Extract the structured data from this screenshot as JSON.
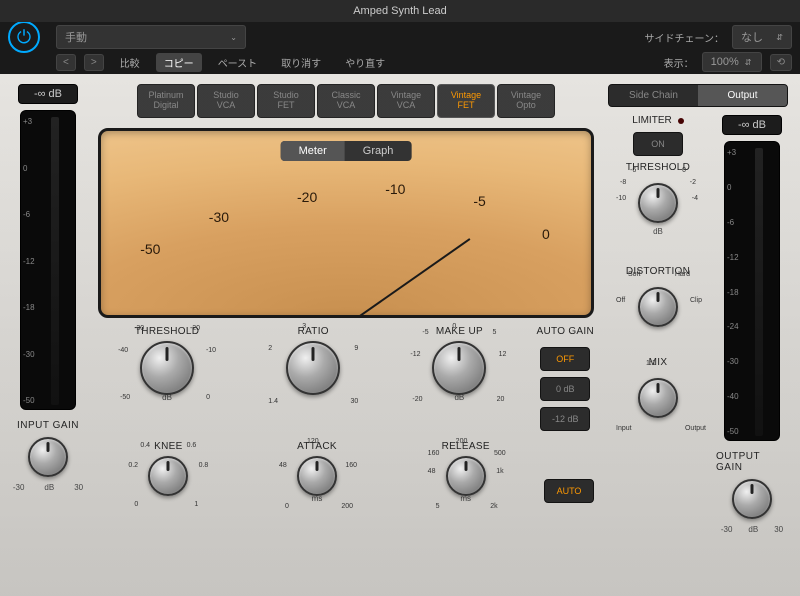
{
  "title": "Amped Synth Lead",
  "toolbar": {
    "preset": "手動",
    "compare": "比較",
    "copy": "コピー",
    "paste": "ペースト",
    "undo": "取り消す",
    "redo": "やり直す",
    "sidechain_label": "サイドチェーン：",
    "sidechain_value": "なし",
    "view_label": "表示：",
    "view_value": "100%"
  },
  "types": [
    {
      "l1": "Platinum",
      "l2": "Digital"
    },
    {
      "l1": "Studio",
      "l2": "VCA"
    },
    {
      "l1": "Studio",
      "l2": "FET"
    },
    {
      "l1": "Classic",
      "l2": "VCA"
    },
    {
      "l1": "Vintage",
      "l2": "VCA"
    },
    {
      "l1": "Vintage",
      "l2": "FET"
    },
    {
      "l1": "Vintage",
      "l2": "Opto"
    }
  ],
  "active_type": 5,
  "sc_tabs": {
    "side_chain": "Side Chain",
    "output": "Output"
  },
  "input": {
    "db": "-∞ dB",
    "label": "INPUT GAIN",
    "scale": [
      "+3",
      "0",
      "-6",
      "-12",
      "-18",
      "-30",
      "-50"
    ],
    "unit": "dB",
    "range": [
      "-30",
      "30"
    ]
  },
  "output": {
    "db": "-∞ dB",
    "label": "OUTPUT GAIN",
    "scale": [
      "+3",
      "0",
      "-6",
      "-12",
      "-18",
      "-24",
      "-30",
      "-40",
      "-50"
    ],
    "unit": "dB",
    "range": [
      "-30",
      "30"
    ]
  },
  "vu": {
    "meter": "Meter",
    "graph": "Graph",
    "marks": [
      "-50",
      "-30",
      "-20",
      "-10",
      "-5",
      "0"
    ]
  },
  "main_knobs": {
    "threshold": {
      "title": "THRESHOLD",
      "ticks": [
        "-50",
        "-40",
        "-30",
        "-20",
        "-10",
        "0"
      ],
      "unit": "dB"
    },
    "ratio": {
      "title": "RATIO",
      "ticks": [
        "1.4",
        "2",
        "3",
        "9",
        "30"
      ]
    },
    "makeup": {
      "title": "MAKE UP",
      "ticks": [
        "-20",
        "-12",
        "-5",
        "0",
        "5",
        "12",
        "20"
      ],
      "unit": "dB"
    },
    "autogain": {
      "title": "AUTO GAIN",
      "off": "OFF",
      "zero": "0 dB",
      "minus12": "-12 dB"
    }
  },
  "sub_knobs": {
    "knee": {
      "title": "KNEE",
      "ticks": [
        "0",
        "0.2",
        "0.4",
        "0.6",
        "0.8",
        "1"
      ]
    },
    "attack": {
      "title": "ATTACK",
      "ticks": [
        "0",
        "48",
        "120",
        "160",
        "200"
      ],
      "unit": "ms"
    },
    "release": {
      "title": "RELEASE",
      "ticks": [
        "5",
        "48",
        "160",
        "200",
        "500",
        "1k",
        "2k"
      ],
      "unit": "ms"
    },
    "auto": "AUTO"
  },
  "limiter": {
    "label": "LIMITER",
    "on": "ON",
    "threshold": "THRESHOLD",
    "ticks": [
      "0",
      "-2",
      "-4",
      "-6",
      "-8",
      "-10"
    ],
    "unit": "dB"
  },
  "distortion": {
    "label": "DISTORTION",
    "ticks": [
      "Off",
      "Soft",
      "Hard",
      "Clip"
    ]
  },
  "mix": {
    "label": "MIX",
    "ticks": [
      "Input",
      "1:1",
      "Output"
    ]
  }
}
